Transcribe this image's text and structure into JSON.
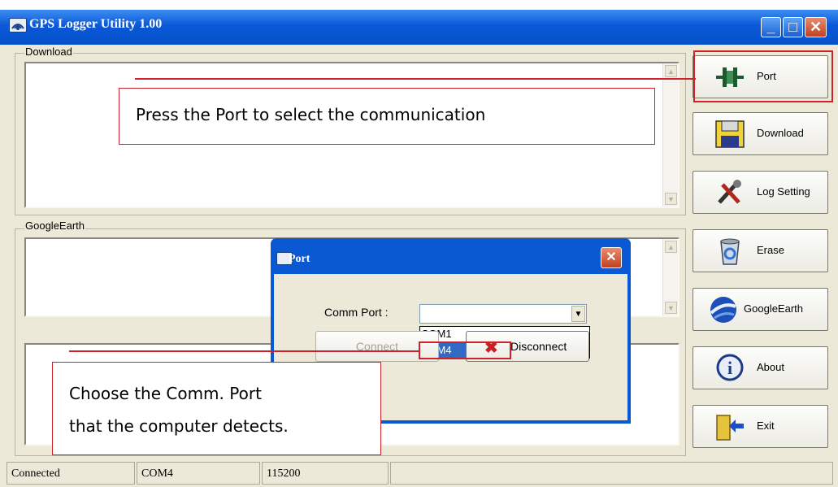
{
  "window": {
    "title": "GPS Logger Utility 1.00"
  },
  "groups": {
    "download": "Download",
    "googleearth": "GoogleEarth"
  },
  "sidebar": {
    "items": [
      {
        "label": "Port",
        "icon": "port-connector-icon"
      },
      {
        "label": "Download",
        "icon": "floppy-disk-icon"
      },
      {
        "label": "Log Setting",
        "icon": "tools-icon"
      },
      {
        "label": "Erase",
        "icon": "recycle-bin-icon"
      },
      {
        "label": "GoogleEarth",
        "icon": "google-earth-icon"
      },
      {
        "label": "About",
        "icon": "info-icon"
      },
      {
        "label": "Exit",
        "icon": "exit-door-icon"
      }
    ]
  },
  "status": {
    "connection": "Connected",
    "port": "COM4",
    "baud": "115200"
  },
  "dialog": {
    "title": "Port",
    "comm_port_label": "Comm Port :",
    "comm_port_value": "",
    "options": [
      "COM1",
      "COM4"
    ],
    "selected_option": "COM4",
    "connect_label": "Connect",
    "disconnect_label": "Disconnect"
  },
  "annotations": {
    "port_hint": "Press the Port to select the communication",
    "comm_hint_line1": "Choose the Comm. Port",
    "comm_hint_line2": "that the computer detects."
  },
  "colors": {
    "titlebar": "#0a58d8",
    "annotation_red": "#d0202a",
    "selection": "#316ac5"
  }
}
